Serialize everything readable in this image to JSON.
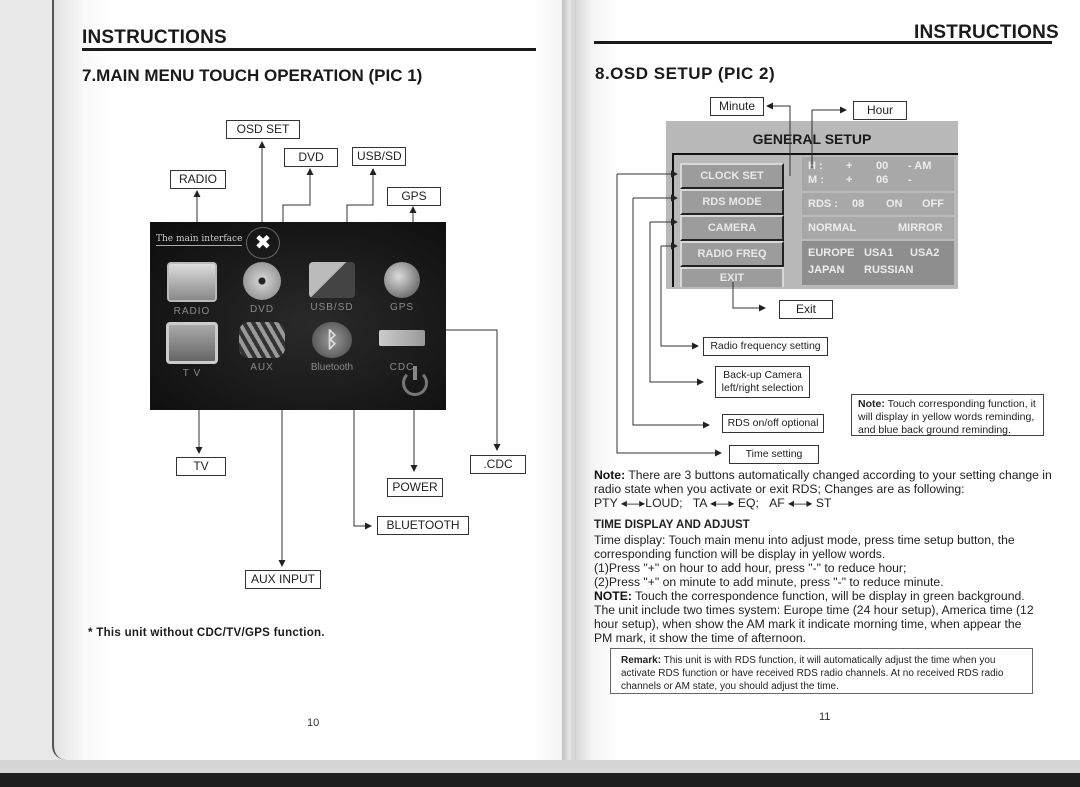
{
  "left_page": {
    "header": "INSTRUCTIONS",
    "section_title": "7.MAIN MENU TOUCH OPERATION (PIC 1)",
    "callouts_top": {
      "osd_set": "OSD SET",
      "radio": "RADIO",
      "dvd": "DVD",
      "usb_sd": "USB/SD",
      "gps": "GPS"
    },
    "callouts_bottom": {
      "tv": "TV",
      "aux_input": "AUX INPUT",
      "bluetooth": "BLUETOOTH",
      "power": "POWER",
      "cdc": ".CDC"
    },
    "main_interface": {
      "title": "The main interface",
      "tool_icon": "wrench-screwdriver-icon",
      "apps": [
        {
          "label": "RADIO",
          "icon": "radio-icon"
        },
        {
          "label": "DVD",
          "icon": "disc-icon"
        },
        {
          "label": "USB/SD",
          "icon": "usb-sd-icon"
        },
        {
          "label": "GPS",
          "icon": "globe-icon"
        },
        {
          "label": "T V",
          "icon": "tv-icon"
        },
        {
          "label": "AUX",
          "icon": "cables-icon"
        },
        {
          "label": "Bluetooth",
          "icon": "bluetooth-icon"
        },
        {
          "label": "CDC",
          "icon": "cd-changer-icon"
        }
      ],
      "power_icon": "power-icon"
    },
    "footnote": "* This unit without CDC/TV/GPS function.",
    "page_number": "10"
  },
  "right_page": {
    "header": "INSTRUCTIONS",
    "section_title": "8.OSD SETUP (PIC 2)",
    "callouts": {
      "minute": "Minute",
      "hour": "Hour",
      "exit": "Exit",
      "radio_freq": "Radio frequency setting",
      "camera_line1": "Back-up Camera",
      "camera_line2": "left/right selection",
      "rds": "RDS on/off optional",
      "time": "Time setting"
    },
    "osd": {
      "title": "GENERAL SETUP",
      "buttons": [
        "CLOCK SET",
        "RDS MODE",
        "CAMERA",
        "RADIO FREQ",
        "EXIT"
      ],
      "clock": {
        "h_label": "H :",
        "h_plus": "+",
        "h_value": "00",
        "h_minus": "- AM",
        "m_label": "M :",
        "m_plus": "+",
        "m_value": "06",
        "m_minus": "-"
      },
      "rds": {
        "label": "RDS :",
        "value": "08",
        "on": "ON",
        "off": "OFF"
      },
      "camera": {
        "normal": "NORMAL",
        "mirror": "MIRROR"
      },
      "regions": [
        "EUROPE",
        "USA1",
        "USA2",
        "JAPAN",
        "RUSSIAN"
      ]
    },
    "side_note": {
      "bold": "Note:",
      "text": " Touch corresponding function, it will display in yellow words reminding, and blue back ground reminding."
    },
    "note": {
      "bold": "Note:",
      "text": " There are 3 buttons automatically changed according to your setting change in radio state when you activate or exit RDS; Changes are as following:",
      "pairs": [
        {
          "a": "PTY",
          "b": "LOUD;"
        },
        {
          "a": "TA",
          "b": "EQ;"
        },
        {
          "a": "AF",
          "b": "ST"
        }
      ]
    },
    "time_section": {
      "heading": "TIME DISPLAY AND ADJUST",
      "intro": "Time display: Touch main menu into adjust mode, press time setup button, the corresponding function will be display in yellow words.",
      "step1": "(1)Press \"+\" on hour to add hour, press \"-\" to reduce hour;",
      "step2": "(2)Press \"+\" on minute to add minute, press \"-\" to reduce minute.",
      "note_bold": "NOTE:",
      "note_text": " Touch the correspondence function, will be display in green background. The unit include two times system: Europe time (24 hour setup), America time (12 hour setup), when show the AM mark it indicate morning time, when appear the PM mark, it show the time of afternoon."
    },
    "remark": {
      "bold": "Remark:",
      "text": " This unit is with RDS function, it will automatically adjust the time when you activate RDS function or have received RDS radio channels. At no received RDS radio channels or AM state, you should adjust the time."
    },
    "page_number": "11"
  }
}
